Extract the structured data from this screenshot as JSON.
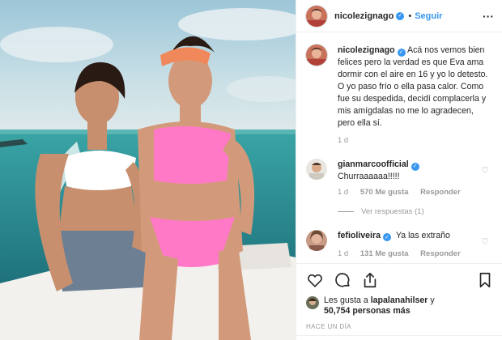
{
  "post": {
    "author": "nicolezignago",
    "follow_label": "Seguir",
    "dot": "•",
    "more_label": "···"
  },
  "caption": {
    "author": "nicolezignago",
    "text": "Acá nos vemos bien felices pero la verdad es que Eva ama dormir con el aire en 16 y yo lo detesto. O yo paso frío o ella pasa calor. Como fue su despedida, decidí complacerla y mis amígdalas no me lo agradecen, pero ella sí.",
    "age": "1 d"
  },
  "comments": [
    {
      "author": "gianmarcoofficial",
      "text": "Churraaaaaa!!!!!",
      "age": "1 d",
      "likes": "570 Me gusta",
      "reply": "Responder",
      "replies_label": "Ver respuestas (1)"
    },
    {
      "author": "fefioliveira",
      "text": "Ya las extraño",
      "age": "1 d",
      "likes": "131 Me gusta",
      "reply": "Responder"
    }
  ],
  "likes_summary": {
    "prefix": "Les gusta a ",
    "user": "lapalanahilser",
    "suffix": " y",
    "count": "50,754 personas más"
  },
  "date": "HACE UN DÍA",
  "icons": {
    "like": "heart-icon",
    "comment": "comment-icon",
    "share": "share-icon",
    "save": "bookmark-icon",
    "verified": "verified-badge-icon",
    "more": "more-options-icon"
  },
  "colors": {
    "accent": "#3897f0",
    "muted": "#999999",
    "border": "#efefef",
    "text": "#262626"
  }
}
